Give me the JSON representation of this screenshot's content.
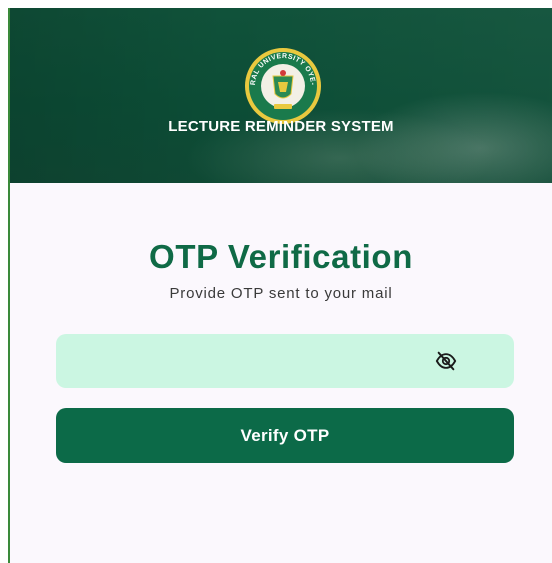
{
  "header": {
    "logo_icon": "university-crest-icon",
    "logo_text": "FEDERAL UNIVERSITY OYE-EKITI",
    "app_title": "LECTURE REMINDER SYSTEM"
  },
  "main": {
    "title": "OTP Verification",
    "subtitle": "Provide OTP sent to your mail",
    "otp_field": {
      "value": "",
      "placeholder": "",
      "visibility_icon": "eye-off-icon"
    },
    "verify_button_label": "Verify OTP"
  },
  "colors": {
    "primary_green": "#0c6a48",
    "title_green": "#0f6a46",
    "field_background": "#cbf6e2",
    "page_background": "#fbf8fd",
    "header_background": "#0c4d36"
  }
}
